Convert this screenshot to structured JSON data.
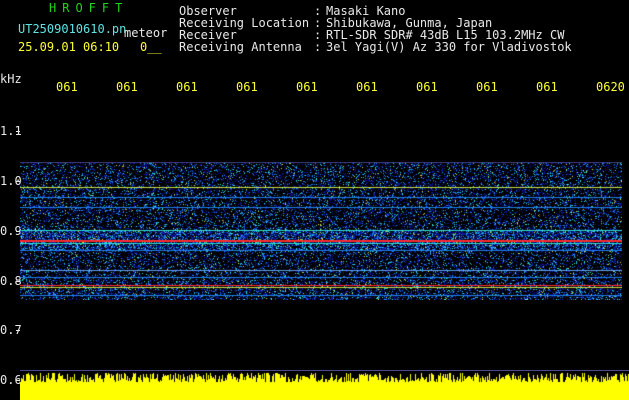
{
  "header": {
    "title": "HROFFT",
    "filename": "UT2509010610.pn",
    "filename_suffix": "meteor",
    "timestamp": "25.09.01 06:10",
    "counter": "0__",
    "fields": [
      {
        "label": "Observer",
        "value": "Masaki Kano"
      },
      {
        "label": "Receiving Location",
        "value": "Shibukawa, Gunma, Japan"
      },
      {
        "label": "Receiver",
        "value": "RTL-SDR SDR# 43dB L15 103.2MHz CW"
      },
      {
        "label": "Receiving Antenna",
        "value": "3el Yagi(V) Az 330 for Vladivostok"
      }
    ],
    "separator": ":"
  },
  "axis": {
    "unit": "kHz",
    "x_ticks": [
      "061",
      "061",
      "061",
      "061",
      "061",
      "061",
      "061",
      "061",
      "061",
      "0620"
    ],
    "y_ticks": [
      "1.1",
      "1.0",
      "0.9",
      "0.8",
      "0.7",
      "0.6"
    ]
  },
  "spectrogram": {
    "freq_range": [
      0.6,
      1.15
    ],
    "signal_band": [
      0.76,
      1.03
    ],
    "strong_lines_khz": [
      0.985,
      0.88,
      0.79
    ],
    "colors": {
      "background": "#000000",
      "low": "#0a1a9e",
      "mid": "#1f7fe8",
      "high": "#2ee0d0",
      "peak": "#ff2a2a",
      "amplitude": "#ffff00",
      "header_text": "#e8e8e8",
      "title_text": "#21d421",
      "filename_text": "#5fe3e3",
      "tick_text": "#ffff33"
    }
  }
}
